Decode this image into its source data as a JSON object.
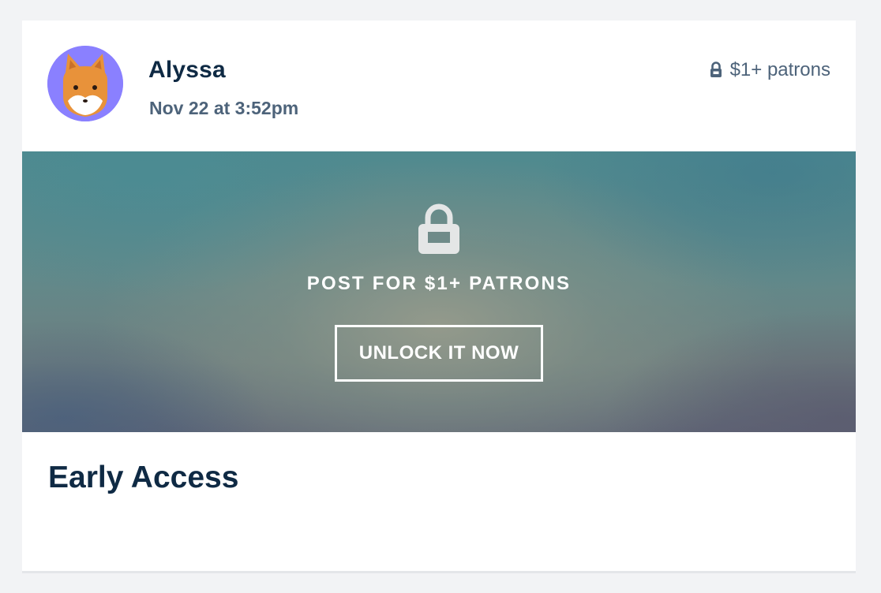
{
  "post": {
    "author": "Alyssa",
    "timestamp": "Nov 22 at 3:52pm",
    "tier_label": "$1+ patrons",
    "locked_message": "POST FOR $1+ PATRONS",
    "unlock_button": "UNLOCK IT NOW",
    "title": "Early Access"
  },
  "icons": {
    "avatar": "fox-avatar-icon",
    "tier": "lock-icon",
    "locked": "lock-icon"
  },
  "colors": {
    "avatar_bg": "#8a80ff",
    "fox": "#e8923a",
    "text_dark": "#0f2a44",
    "text_muted": "#4d637a"
  }
}
